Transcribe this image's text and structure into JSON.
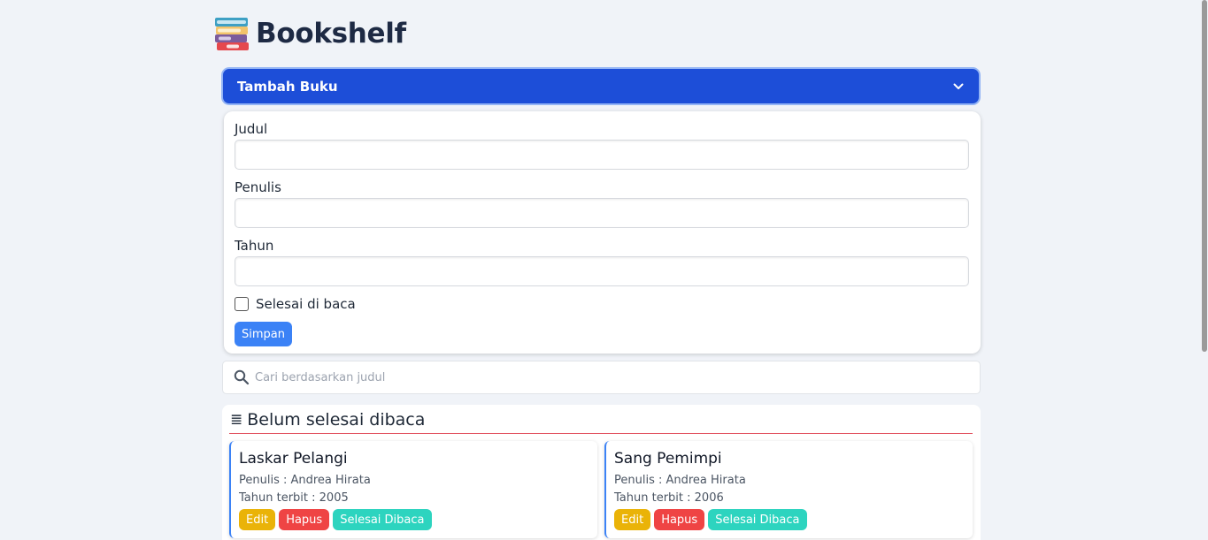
{
  "app": {
    "title": "Bookshelf"
  },
  "accordion": {
    "label": "Tambah Buku"
  },
  "form": {
    "title_label": "Judul",
    "title_value": "",
    "author_label": "Penulis",
    "author_value": "",
    "year_label": "Tahun",
    "year_value": "",
    "finished_label": "Selesai di baca",
    "finished_checked": false,
    "save_label": "Simpan"
  },
  "search": {
    "placeholder": "Cari berdasarkan judul"
  },
  "unread_shelf": {
    "icon": "list-icon",
    "title": "Belum selesai dibaca",
    "books": [
      {
        "title": "Laskar Pelangi",
        "author_text": "Penulis : Andrea Hirata",
        "year_text": "Tahun terbit : 2005",
        "edit_label": "Edit",
        "delete_label": "Hapus",
        "done_label": "Selesai Dibaca"
      },
      {
        "title": "Sang Pemimpi",
        "author_text": "Penulis : Andrea Hirata",
        "year_text": "Tahun terbit : 2006",
        "edit_label": "Edit",
        "delete_label": "Hapus",
        "done_label": "Selesai Dibaca"
      }
    ]
  },
  "colors": {
    "accent": "#1d4ed8",
    "save": "#3b82f6",
    "edit": "#eab308",
    "delete": "#ef4444",
    "done": "#2dd4bf",
    "divider": "#e25563"
  }
}
